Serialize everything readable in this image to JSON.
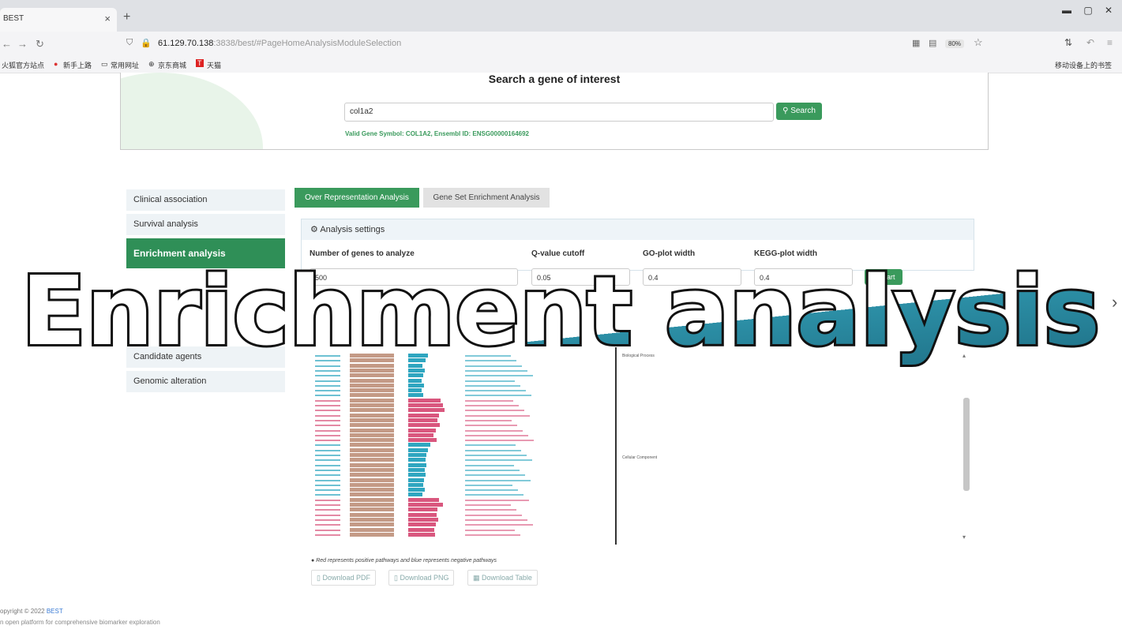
{
  "browser": {
    "tab_title": "BEST",
    "tab_close": "×",
    "new_tab": "+",
    "url_host": "61.129.70.138",
    "url_path": ":3838/best/#PageHomeAnalysisModuleSelection",
    "zoom": "80%",
    "bookmarks": [
      "火狐官方站点",
      "新手上路",
      "常用网址",
      "京东商城",
      "天猫"
    ],
    "mobile_bookmark": "移动设备上的书签"
  },
  "search": {
    "title": "Search a gene of interest",
    "value": "col1a2",
    "button": "Search",
    "valid_text": "Valid Gene Symbol: COL1A2, Ensembl ID: ENSG00000164692"
  },
  "sidebar": {
    "items": [
      {
        "label": "Clinical association"
      },
      {
        "label": "Survival analysis"
      },
      {
        "label": "Enrichment analysis"
      },
      {
        "label": "Candidate agents"
      },
      {
        "label": "Genomic alteration"
      }
    ]
  },
  "tabs": [
    "Over Representation Analysis",
    "Gene Set Enrichment Analysis"
  ],
  "settings": {
    "header": "Analysis settings",
    "labels": [
      "Number of genes to analyze",
      "Q-value cutoff",
      "GO-plot width",
      "KEGG-plot width"
    ],
    "values": [
      "500",
      "0.05",
      "0.4",
      "0.4"
    ],
    "start": "Start"
  },
  "plot": {
    "sections": [
      "Biological Process",
      "Cellular Component"
    ],
    "note": "Red represents positive pathways and blue represents negative pathways",
    "colors": {
      "positive": "#d9577e",
      "negative": "#2fa6c0",
      "bar": "#c49a86"
    }
  },
  "downloads": [
    "Download PDF",
    "Download PNG",
    "Download Table"
  ],
  "footer": {
    "copyright_prefix": "opyright © 2022 ",
    "brand": "BEST",
    "tagline": "n open platform for comprehensive biomarker exploration"
  },
  "overlay": {
    "caption": "Enrichment analysis"
  }
}
